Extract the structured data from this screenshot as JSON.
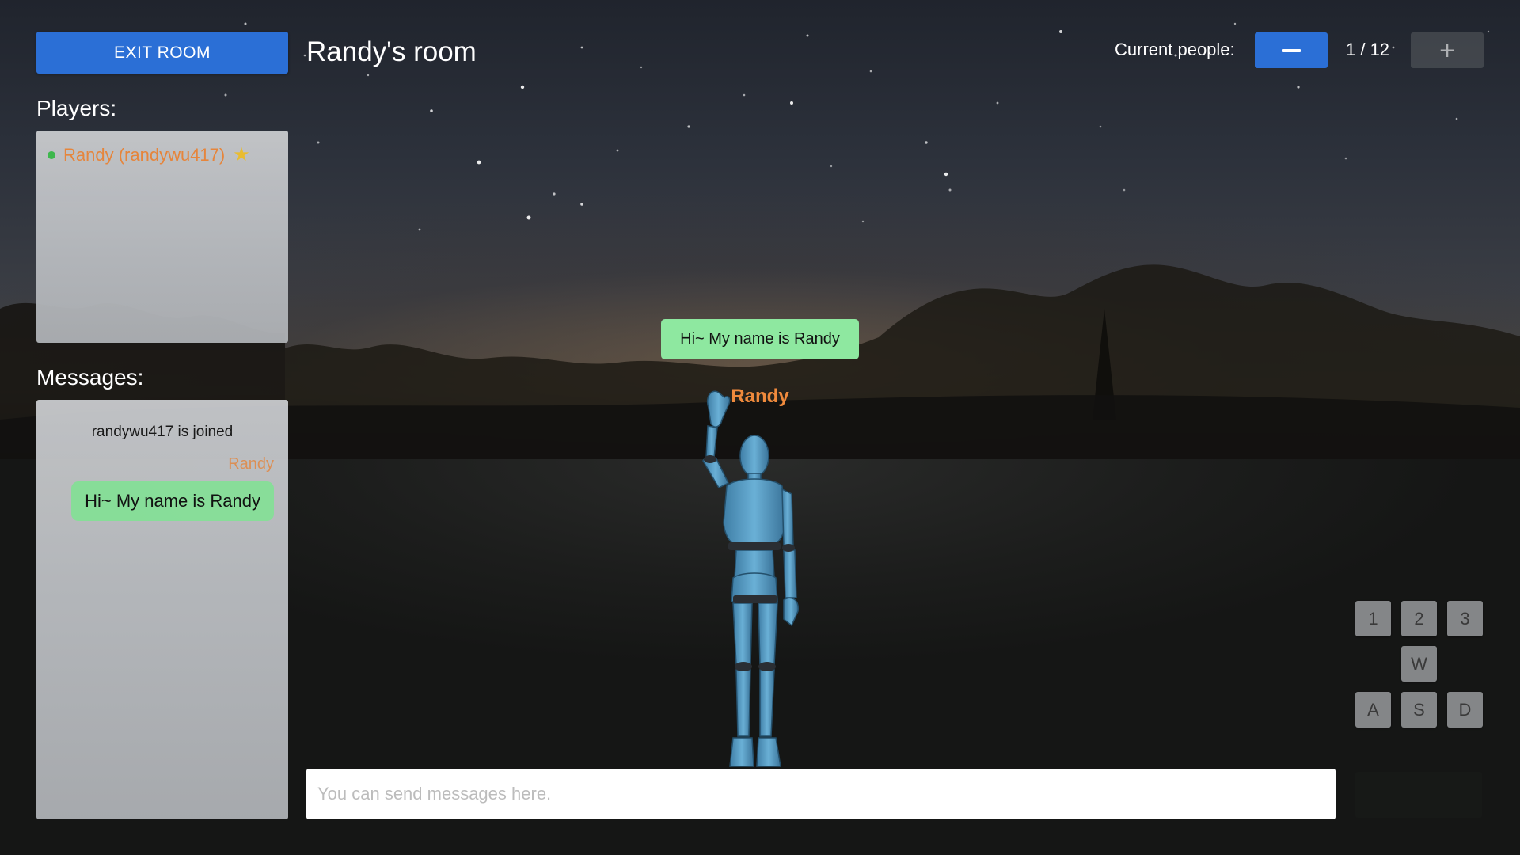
{
  "header": {
    "exit_label": "EXIT ROOM",
    "room_title": "Randy's room",
    "people_label": "Current people:",
    "people_count": "1 / 12",
    "minus_icon": "minus-icon",
    "plus_icon": "plus-icon"
  },
  "players": {
    "label": "Players:",
    "items": [
      {
        "name": "Randy (randywu417)",
        "status": "online",
        "host_icon": "star-icon"
      }
    ]
  },
  "messages": {
    "label": "Messages:",
    "system": "randywu417 is joined",
    "chat": [
      {
        "sender": "Randy",
        "text": "Hi~ My name is Randy"
      }
    ]
  },
  "scene": {
    "speech_bubble": "Hi~ My name is Randy",
    "avatar_name": "Randy"
  },
  "keys": {
    "row1": [
      "1",
      "2",
      "3"
    ],
    "row2": [
      "W"
    ],
    "row3": [
      "A",
      "S",
      "D"
    ]
  },
  "chat_input": {
    "value": "",
    "placeholder": "You can send messages here."
  },
  "colors": {
    "accent_blue": "#2b6fd6",
    "name_orange": "#f08a3c",
    "bubble_green": "#8ee8a0",
    "online_green": "#3fbf4f",
    "star_yellow": "#f4c430"
  }
}
